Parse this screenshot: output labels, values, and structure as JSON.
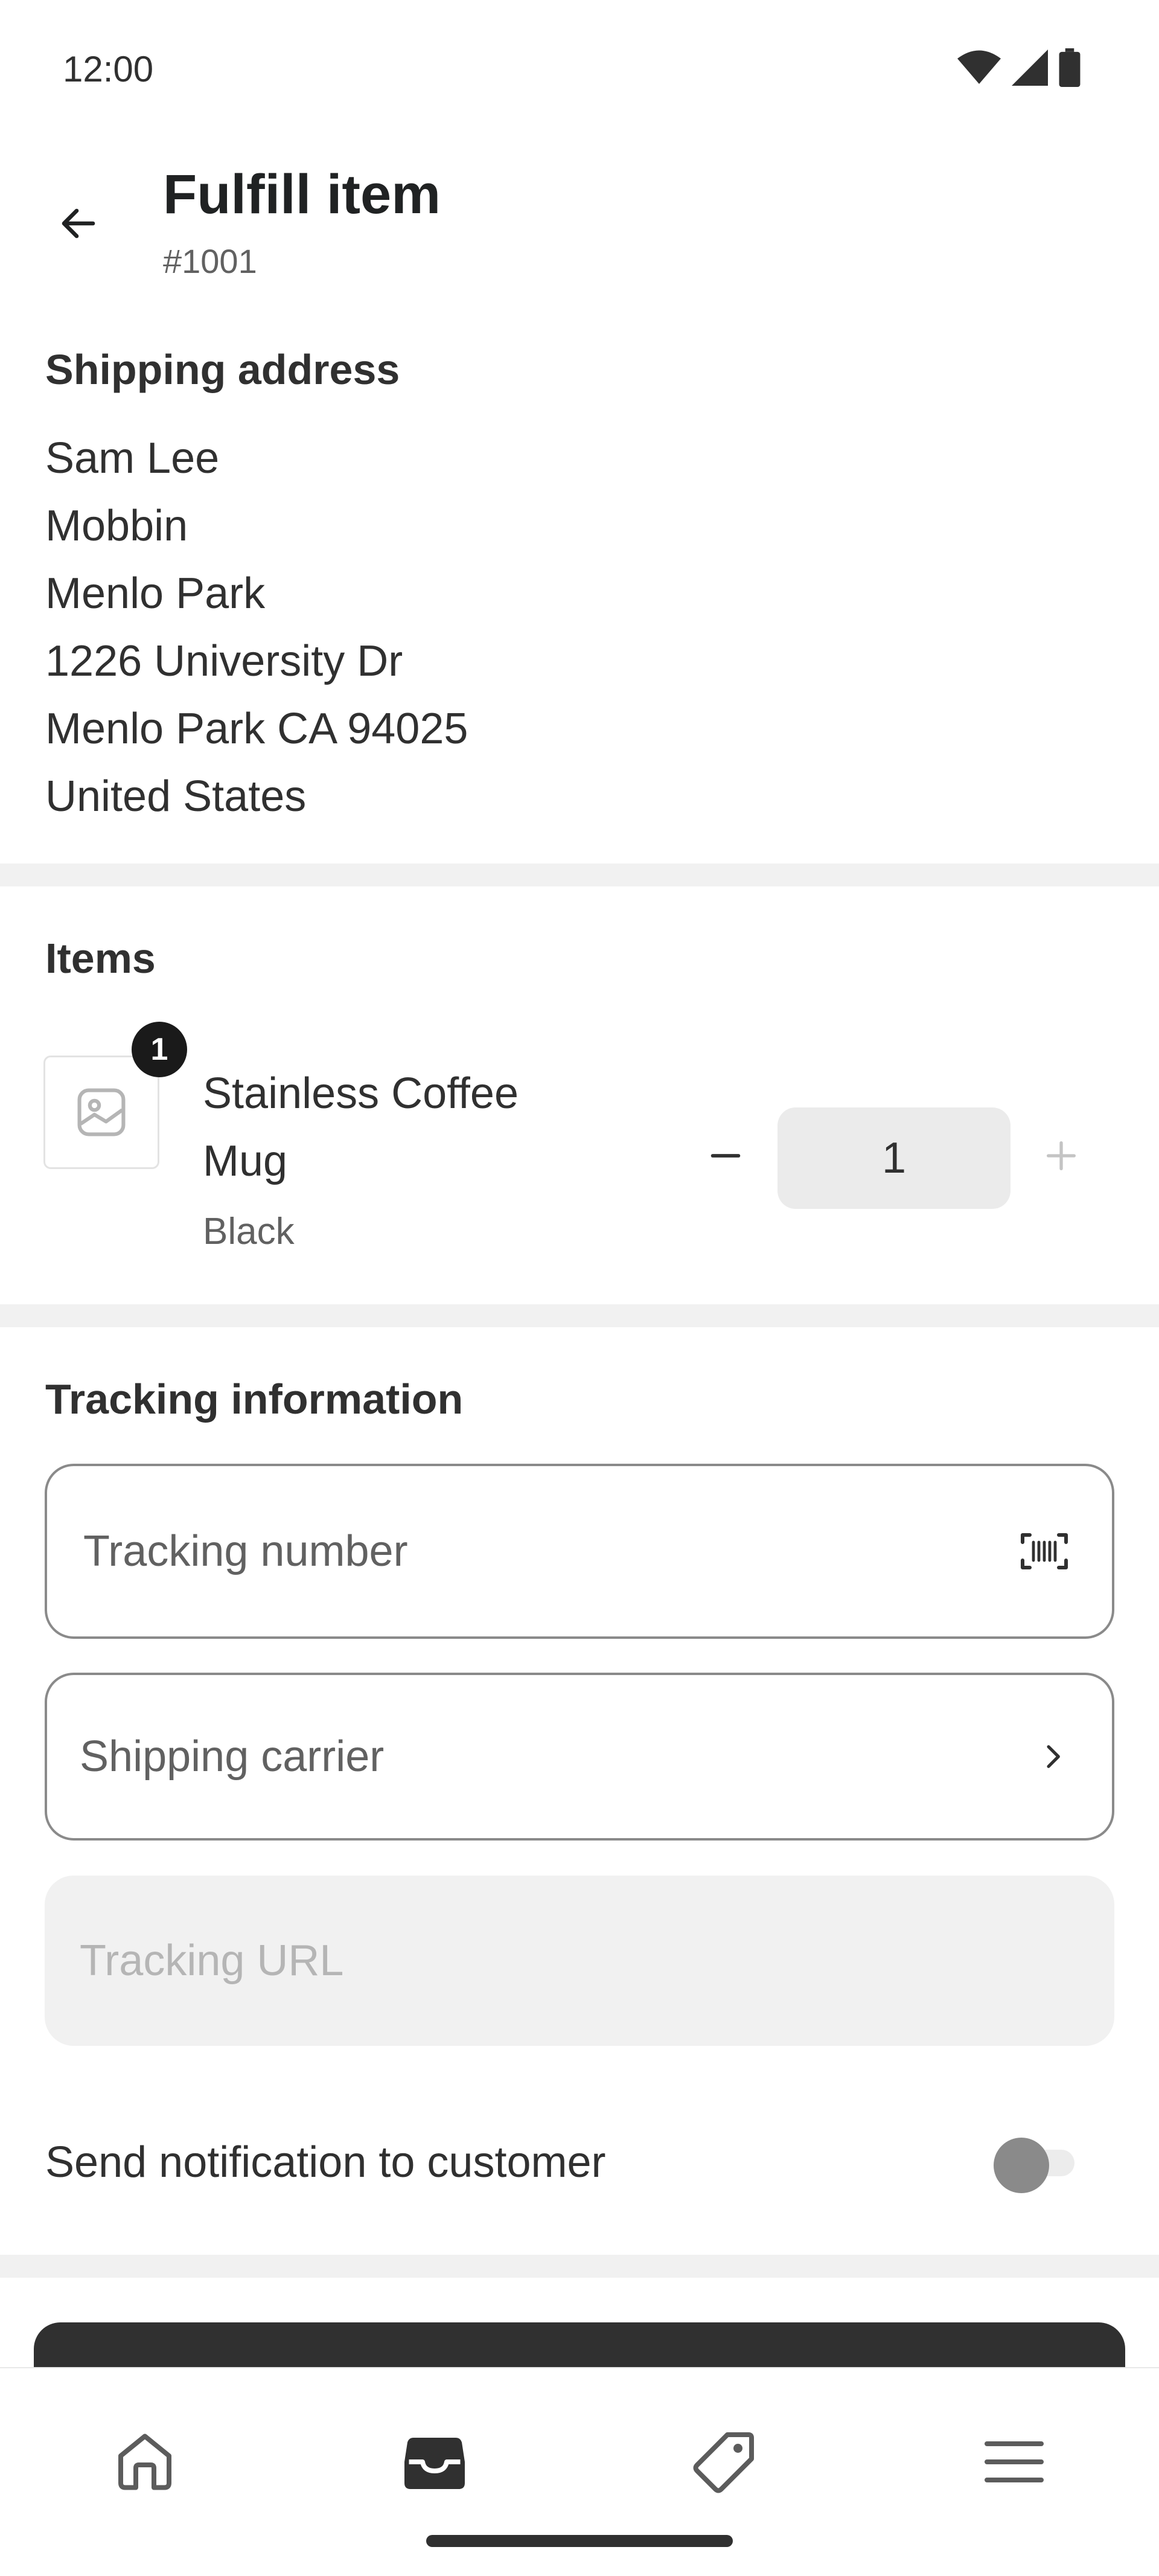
{
  "status_bar": {
    "time": "12:00"
  },
  "header": {
    "title": "Fulfill item",
    "order_number": "#1001"
  },
  "shipping_address": {
    "title": "Shipping address",
    "lines": [
      "Sam Lee",
      "Mobbin",
      "Menlo Park",
      "1226 University Dr",
      "Menlo Park CA 94025",
      "United States"
    ]
  },
  "items": {
    "title": "Items",
    "list": [
      {
        "badge": "1",
        "name_line1": "Stainless Coffee",
        "name_line2": "Mug",
        "variant": "Black",
        "quantity": "1"
      }
    ]
  },
  "tracking": {
    "title": "Tracking information",
    "tracking_number_placeholder": "Tracking number",
    "carrier_placeholder": "Shipping carrier",
    "url_placeholder": "Tracking URL"
  },
  "notification": {
    "label": "Send notification to customer",
    "enabled": false
  },
  "nav": {
    "items": [
      "home-icon",
      "orders-inbox-icon",
      "products-tag-icon",
      "menu-icon"
    ],
    "active_index": 1
  },
  "colors": {
    "text": "#303030",
    "secondary": "#616161",
    "divider": "#f1f1f1",
    "primary_button": "#303030"
  }
}
